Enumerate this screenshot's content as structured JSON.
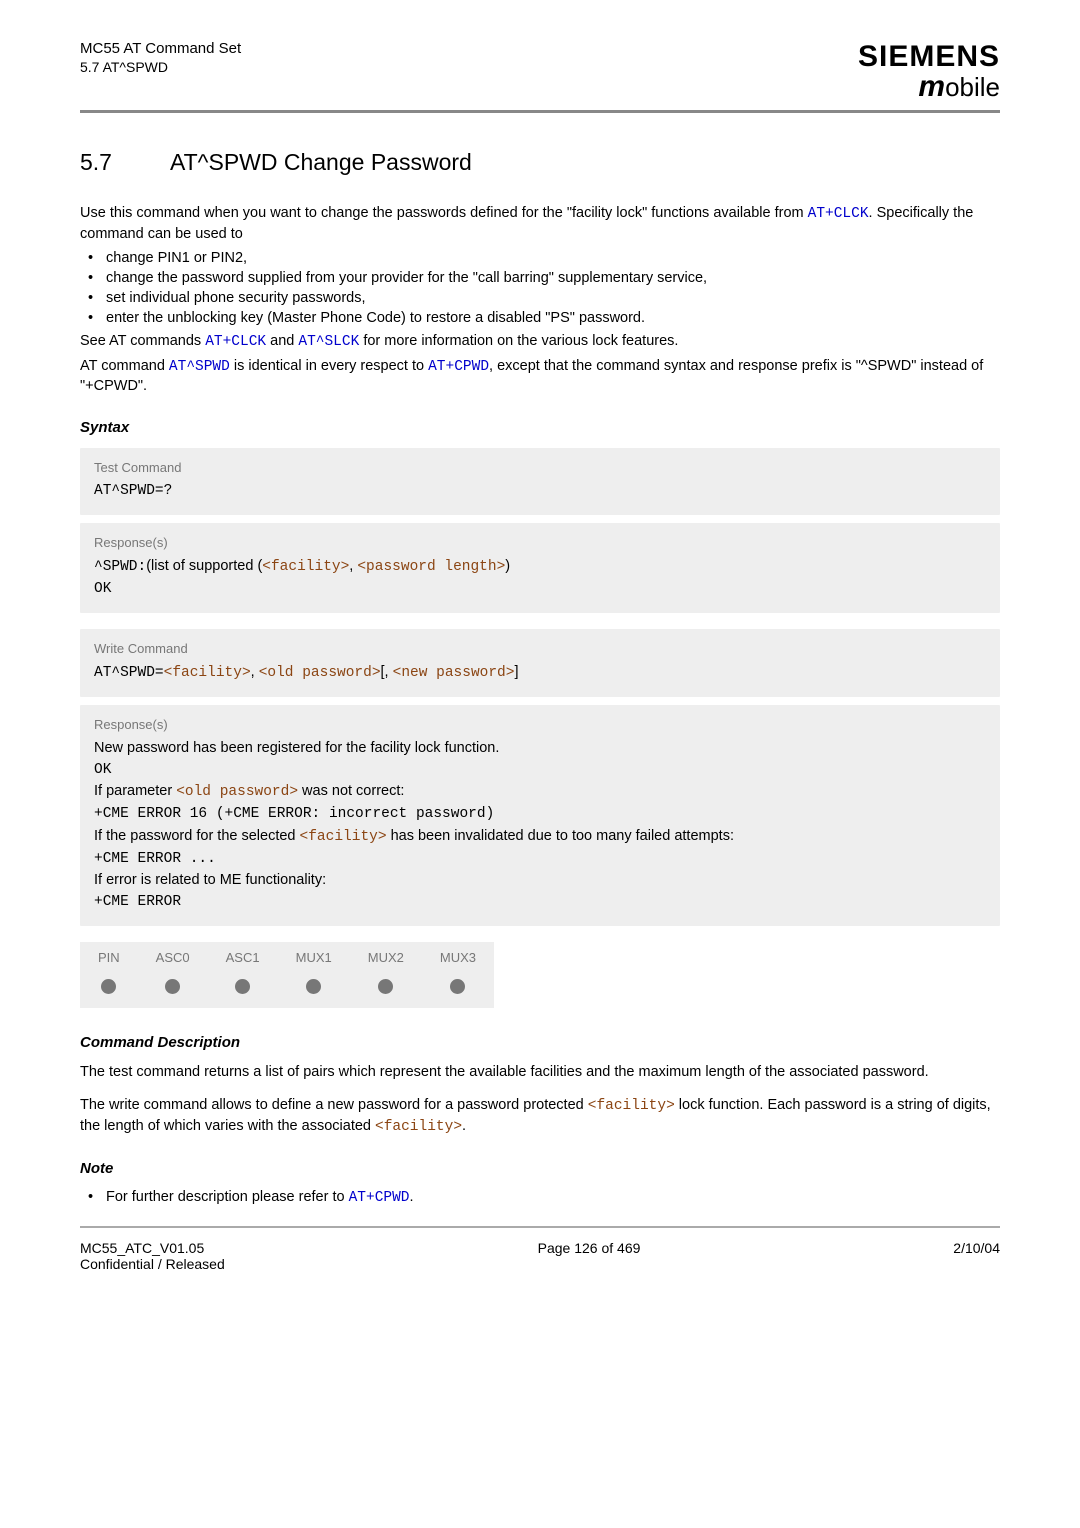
{
  "header": {
    "title": "MC55 AT Command Set",
    "sub": "5.7 AT^SPWD",
    "brand": "SIEMENS",
    "brand_sub": "obile",
    "brand_m": "m"
  },
  "section": {
    "number": "5.7",
    "title": "AT^SPWD   Change Password"
  },
  "intro": {
    "lead": "Use this command when you want to change the passwords defined for the \"facility lock\" functions available from ",
    "link1": "AT+CLCK",
    "lead2": ". Specifically the command can be used to",
    "bullets": [
      "change PIN1 or PIN2,",
      "change the password supplied from your provider for the \"call barring\" supplementary service,",
      "set individual phone security passwords,",
      "enter the unblocking key (Master Phone Code) to restore a disabled \"PS\" password."
    ],
    "see1": "See AT commands ",
    "link2": "AT+CLCK",
    "see2": " and ",
    "link3": "AT^SLCK",
    "see3": " for more information on the various lock features.",
    "at1": "AT command ",
    "link4": "AT^SPWD",
    "at2": " is identical in every respect to ",
    "link5": "AT+CPWD",
    "at3": ", except that the command syntax and response prefix is \"^SPWD\" instead of \"+CPWD\"."
  },
  "syntax_label": "Syntax",
  "test_box": {
    "label": "Test Command",
    "cmd": "AT^SPWD=?",
    "resp_label": "Response(s)",
    "resp_pre": "^SPWD:",
    "resp_mid": "(list of supported (",
    "p1": "<facility>",
    "comma1": ", ",
    "p2": "<password length>",
    "resp_end": ")",
    "ok": "OK"
  },
  "write_box": {
    "label": "Write Command",
    "pre": "AT^SPWD=",
    "p1": "<facility>",
    "comma1": ", ",
    "p2": "<old password>",
    "br1": "[, ",
    "p3": "<new password>",
    "br2": "]",
    "resp_label": "Response(s)",
    "line1": "New password has been registered for the facility lock function.",
    "ok1": "OK",
    "line2a": "If parameter ",
    "line2p": "<old password>",
    "line2b": " was not correct:",
    "err1": "+CME ERROR 16 (+CME ERROR: incorrect password)",
    "line3a": "If the password for the selected ",
    "line3p": "<facility>",
    "line3b": " has been invalidated due to too many failed attempts:",
    "err2": "+CME ERROR ...",
    "line4": "If error is related to ME functionality:",
    "err3": "+CME ERROR"
  },
  "icons": {
    "h1": "PIN",
    "h2": "ASC0",
    "h3": "ASC1",
    "h4": "MUX1",
    "h5": "MUX2",
    "h6": "MUX3"
  },
  "cmd_desc": {
    "heading": "Command Description",
    "p1": "The test command returns a list of pairs which represent the available facilities and the maximum length of the associated password.",
    "p2a": "The write command allows to define a new password for a password protected ",
    "p2p1": "<facility>",
    "p2b": " lock function. Each password is a string of digits, the length of which varies with the associated ",
    "p2p2": "<facility>",
    "p2c": "."
  },
  "note": {
    "heading": "Note",
    "b1a": "For further description please refer to ",
    "b1link": "AT+CPWD",
    "b1b": "."
  },
  "footer": {
    "left1": "MC55_ATC_V01.05",
    "left2": "Confidential / Released",
    "center": "Page 126 of 469",
    "right": "2/10/04"
  }
}
